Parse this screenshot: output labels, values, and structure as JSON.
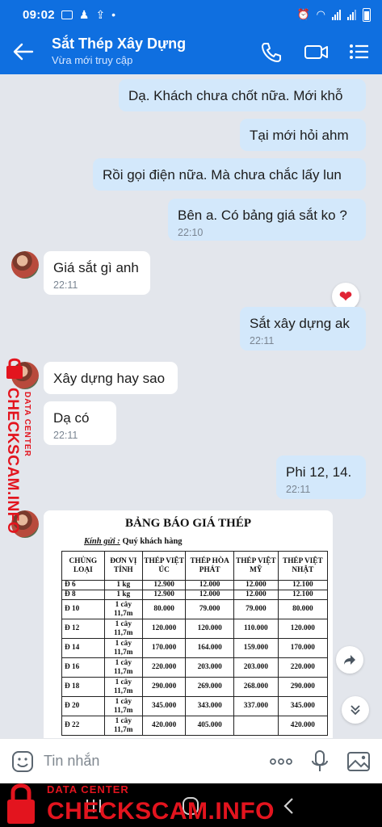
{
  "status_bar": {
    "time": "09:02"
  },
  "header": {
    "title": "Sắt Thép Xây Dựng",
    "subtitle": "Vừa mới truy cập"
  },
  "messages": [
    {
      "dir": "out",
      "text": "Dạ. Khách chưa chốt nữa. Mới khỗ",
      "time": ""
    },
    {
      "dir": "out",
      "text": "Tại mới hỏi ahm",
      "time": ""
    },
    {
      "dir": "out",
      "text": "Rồi gọi điện nữa. Mà chưa chắc lấy lun",
      "time": ""
    },
    {
      "dir": "out",
      "text": "Bên a. Có bảng giá sắt ko ?",
      "time": "22:10"
    },
    {
      "dir": "in",
      "text": "Giá sắt gì anh",
      "time": "22:11"
    },
    {
      "dir": "out",
      "text": "Sắt xây dựng ak",
      "time": "22:11"
    },
    {
      "dir": "in",
      "text": "Xây dựng hay sao",
      "time": ""
    },
    {
      "dir": "in",
      "text": "Dạ có",
      "time": "22:11"
    },
    {
      "dir": "out",
      "text": "Phi 12, 14.",
      "time": "22:11"
    }
  ],
  "reaction": {
    "emoji": "❤"
  },
  "price_image": {
    "title": "BẢNG BÁO GIÁ THÉP",
    "greeting_label": "Kính gửi :",
    "greeting_value": "Quý khách hàng",
    "columns": [
      "CHỦNG LOẠI",
      "ĐƠN VỊ TÍNH",
      "THÉP VIỆT ÚC",
      "THÉP HÒA PHÁT",
      "THÉP VIỆT MỸ",
      "THÉP VIỆT NHẬT"
    ],
    "rows": [
      [
        "Ð 6",
        "1 kg",
        "12.900",
        "12.000",
        "12.000",
        "12.100"
      ],
      [
        "Ð 8",
        "1 kg",
        "12.900",
        "12.000",
        "12.000",
        "12.100"
      ],
      [
        "Ð 10",
        "1 cây 11,7m",
        "80.000",
        "79.000",
        "79.000",
        "80.000"
      ],
      [
        "Ð 12",
        "1 cây 11,7m",
        "120.000",
        "120.000",
        "110.000",
        "120.000"
      ],
      [
        "Ð 14",
        "1 cây 11,7m",
        "170.000",
        "164.000",
        "159.000",
        "170.000"
      ],
      [
        "Ð 16",
        "1 cây 11,7m",
        "220.000",
        "203.000",
        "203.000",
        "220.000"
      ],
      [
        "Ð 18",
        "1 cây 11,7m",
        "290.000",
        "269.000",
        "268.000",
        "290.000"
      ],
      [
        "Ð 20",
        "1 cây 11,7m",
        "345.000",
        "343.000",
        "337.000",
        "345.000"
      ],
      [
        "Ð 22",
        "1 cây 11,7m",
        "420.000",
        "405.000",
        "",
        "420.000"
      ]
    ]
  },
  "input_bar": {
    "placeholder": "Tin nhắn"
  },
  "watermark": {
    "small": "DATA CENTER",
    "big": "CHECKSCAM.INFO"
  },
  "colors": {
    "header": "#0f6fe0",
    "bubble_out": "#d3e8fb",
    "bubble_in": "#ffffff",
    "chat_bg": "#e3e6ec",
    "watermark": "#e3141e"
  }
}
